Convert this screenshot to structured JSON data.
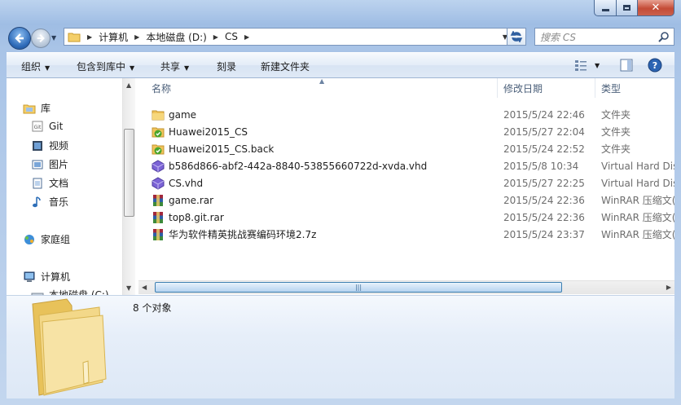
{
  "address": {
    "crumbs": [
      "计算机",
      "本地磁盘 (D:)",
      "CS"
    ]
  },
  "search": {
    "placeholder": "搜索 CS"
  },
  "toolbar": {
    "organize": "组织",
    "include_in_library": "包含到库中",
    "share": "共享",
    "burn": "刻录",
    "new_folder": "新建文件夹"
  },
  "nav_pane": {
    "libraries": "库",
    "items": [
      "Git",
      "视频",
      "图片",
      "文档",
      "音乐"
    ],
    "homegroup": "家庭组",
    "computer": "计算机",
    "drive_c": "本地磁盘 (C:)"
  },
  "columns": {
    "name": "名称",
    "date": "修改日期",
    "type": "类型"
  },
  "files": [
    {
      "name": "game",
      "date": "2015/5/24 22:46",
      "type": "文件夹",
      "icon": "folder-icon"
    },
    {
      "name": "Huawei2015_CS",
      "date": "2015/5/27 22:04",
      "type": "文件夹",
      "icon": "synced-folder-icon"
    },
    {
      "name": "Huawei2015_CS.back",
      "date": "2015/5/24 22:52",
      "type": "文件夹",
      "icon": "synced-folder-icon"
    },
    {
      "name": "b586d866-abf2-442a-8840-53855660722d-xvda.vhd",
      "date": "2015/5/8 10:34",
      "type": "Virtual Hard Dis",
      "icon": "vhd-icon"
    },
    {
      "name": "CS.vhd",
      "date": "2015/5/27 22:25",
      "type": "Virtual Hard Dis",
      "icon": "vhd-icon"
    },
    {
      "name": "game.rar",
      "date": "2015/5/24 22:36",
      "type": "WinRAR 压缩文(",
      "icon": "rar-icon"
    },
    {
      "name": "top8.git.rar",
      "date": "2015/5/24 22:36",
      "type": "WinRAR 压缩文(",
      "icon": "rar-icon"
    },
    {
      "name": "华为软件精英挑战赛编码环境2.7z",
      "date": "2015/5/24 23:37",
      "type": "WinRAR 压缩文(",
      "icon": "rar-icon"
    }
  ],
  "details": {
    "count": "8 个对象"
  },
  "colors": {
    "titlebar": "#a9c4e7",
    "close": "#c44b36",
    "selection": "#3c7fb1"
  }
}
